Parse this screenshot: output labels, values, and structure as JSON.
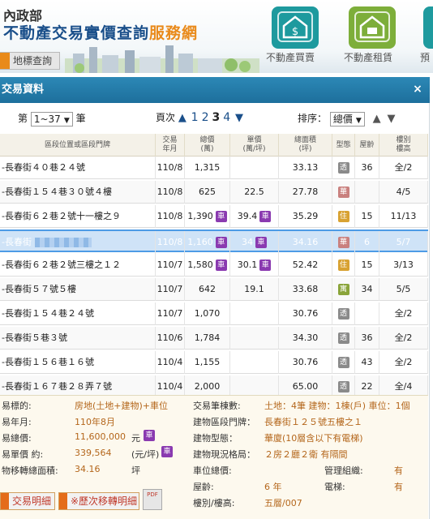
{
  "header": {
    "ministry": "內政部",
    "title_main": "不動產交易實價查詢",
    "title_sub": "服務網",
    "map_button": "地標查詢",
    "nav": [
      {
        "label": "不動產買賣",
        "icon": "house-dollar-icon",
        "color": "#1e9a9e"
      },
      {
        "label": "不動產租賃",
        "icon": "house-rent-icon",
        "color": "#7dae3a"
      },
      {
        "label": "預",
        "icon": "presale-icon",
        "color": "#1e9a9e"
      }
    ]
  },
  "panel": {
    "title": "交易資料",
    "close": "×",
    "page_prefix": "第",
    "page_select": "1~37",
    "page_suffix": "筆",
    "pager_label": "頁次",
    "pages": [
      "1",
      "2",
      "3",
      "4"
    ],
    "current_page": "3",
    "sort_label": "排序：",
    "sort_select": "總價"
  },
  "table": {
    "headers": [
      "區段位置或區段門牌",
      "交易\n年月",
      "總價\n(萬)",
      "單價\n(萬/坪)",
      "總面積\n(坪)",
      "型態",
      "屋齡",
      "樓別\n樓高"
    ],
    "rows": [
      {
        "addr": "-長春街４０巷２４號",
        "date": "110/8",
        "total": "1,315",
        "total_car": false,
        "unit": "",
        "unit_car": false,
        "area": "33.13",
        "type": "透",
        "type_color": "gray",
        "age": "36",
        "floor": "全/2"
      },
      {
        "addr": "-長春街１５４巷３０號４樓",
        "date": "110/8",
        "total": "625",
        "total_car": false,
        "unit": "22.5",
        "unit_car": false,
        "area": "27.78",
        "type": "華",
        "type_color": "pink",
        "age": "",
        "floor": "4/5"
      },
      {
        "addr": "-長春街６２巷２號十一樓之９",
        "date": "110/8",
        "total": "1,390",
        "total_car": true,
        "unit": "39.4",
        "unit_car": true,
        "area": "35.29",
        "type": "住",
        "type_color": "gold",
        "age": "15",
        "floor": "11/13"
      },
      {
        "addr": "-長春街",
        "date": "110/8",
        "total": "1,160",
        "total_car": true,
        "unit": "34",
        "unit_car": true,
        "area": "34.16",
        "type": "華",
        "type_color": "pink",
        "age": "6",
        "floor": "5/7",
        "selected": true
      },
      {
        "addr": "-長春街６２巷２號三樓之１２",
        "date": "110/7",
        "total": "1,580",
        "total_car": true,
        "unit": "30.1",
        "unit_car": true,
        "area": "52.42",
        "type": "住",
        "type_color": "gold",
        "age": "15",
        "floor": "3/13"
      },
      {
        "addr": "-長春街５７號５樓",
        "date": "110/7",
        "total": "642",
        "total_car": false,
        "unit": "19.1",
        "unit_car": false,
        "area": "33.68",
        "type": "寓",
        "type_color": "olive",
        "age": "34",
        "floor": "5/5"
      },
      {
        "addr": "-長春街１５４巷２４號",
        "date": "110/7",
        "total": "1,070",
        "total_car": false,
        "unit": "",
        "unit_car": false,
        "area": "30.76",
        "type": "透",
        "type_color": "gray",
        "age": "",
        "floor": "全/2"
      },
      {
        "addr": "-長春街５巷３號",
        "date": "110/6",
        "total": "1,784",
        "total_car": false,
        "unit": "",
        "unit_car": false,
        "area": "34.30",
        "type": "透",
        "type_color": "gray",
        "age": "36",
        "floor": "全/2"
      },
      {
        "addr": "-長春街１５６巷１６號",
        "date": "110/4",
        "total": "1,155",
        "total_car": false,
        "unit": "",
        "unit_car": false,
        "area": "30.76",
        "type": "透",
        "type_color": "gray",
        "age": "43",
        "floor": "全/2"
      },
      {
        "addr": "-長春街１６７巷２８弄７號",
        "date": "110/4",
        "total": "2,000",
        "total_car": false,
        "unit": "",
        "unit_car": false,
        "area": "65.00",
        "type": "透",
        "type_color": "gray",
        "age": "22",
        "floor": "全/4"
      }
    ],
    "car_badge": "車"
  },
  "details": {
    "left": [
      {
        "label": "易標的:",
        "value": "房地(土地+建物)+車位"
      },
      {
        "label": "易年月:",
        "value": "110年8月"
      },
      {
        "label": "易總價:",
        "value": "11,600,000",
        "suffix": "元"
      },
      {
        "label": "易單價 約:",
        "value": "339,564",
        "suffix": "(元/坪)"
      },
      {
        "label": "物移轉總面積:",
        "value": "34.16",
        "suffix": "坪"
      }
    ],
    "right": [
      {
        "label": "交易筆棟數:",
        "value": "土地：4筆 建物：1棟(戶) 車位：1個"
      },
      {
        "label": "建物區段門牌：",
        "value": "長春街１２５號五樓之１"
      },
      {
        "label": "建物型態：",
        "value": "華廈(10層含以下有電梯)"
      },
      {
        "label": "建物現況格局：",
        "value": "２房２廳２衛 有隔間"
      },
      {
        "label": "車位總價:",
        "value": ""
      },
      {
        "label": "屋齡:",
        "value": "6 年"
      },
      {
        "label": "樓別/樓高:",
        "value": "五層/007"
      }
    ],
    "mgmt_label": "管理組織:",
    "mgmt_value": "有",
    "elevator_label": "電梯:",
    "elevator_value": "有",
    "btn_detail": "交易明細",
    "btn_history": "※歷次移轉明細",
    "pdf_label": "PDF"
  }
}
